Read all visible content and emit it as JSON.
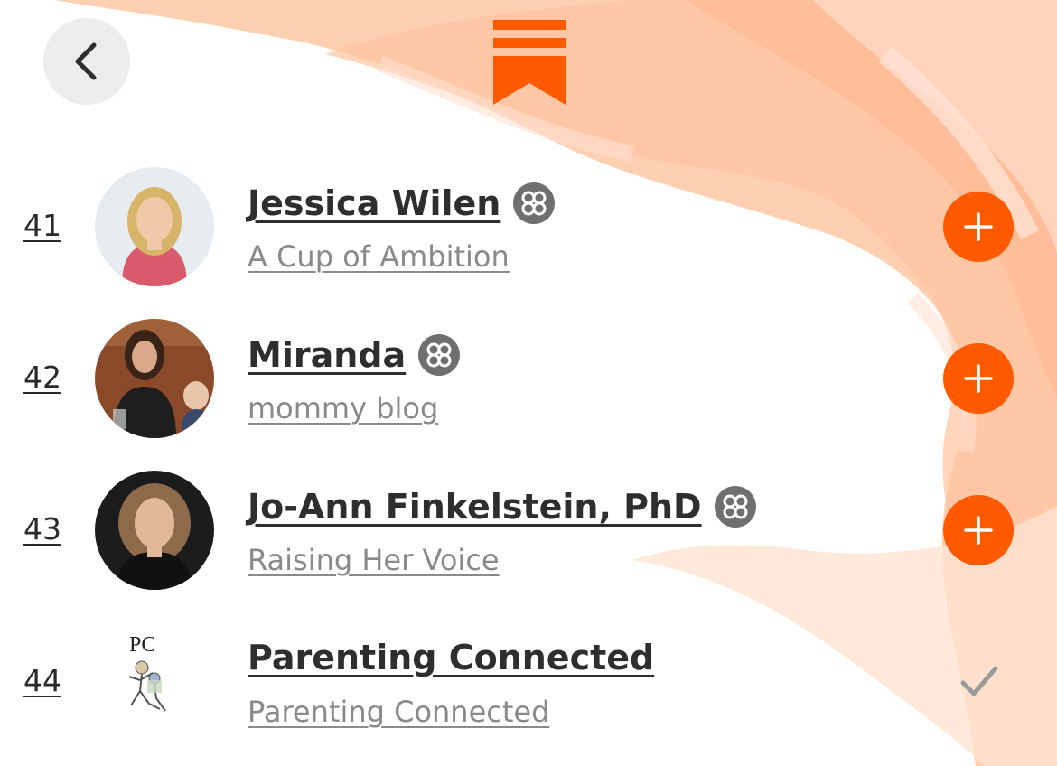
{
  "colors": {
    "accent": "#FF5A00",
    "badge": "#6F6F6F",
    "back_button_bg": "#ECECEC",
    "text_primary": "#2E2E2E",
    "text_secondary": "#8A8A8A",
    "check": "#9A9A9A"
  },
  "header": {
    "back_icon": "chevron-left-icon",
    "logo_icon": "substack-bookmark-icon"
  },
  "leaderboard": [
    {
      "rank": "41",
      "name": "Jessica Wilen",
      "publication": "A Cup of Ambition",
      "has_badge": true,
      "badge_icon": "flower-badge-icon",
      "action": "follow",
      "action_icon": "plus-icon"
    },
    {
      "rank": "42",
      "name": "Miranda",
      "publication": "mommy blog",
      "has_badge": true,
      "badge_icon": "flower-badge-icon",
      "action": "follow",
      "action_icon": "plus-icon"
    },
    {
      "rank": "43",
      "name": "Jo-Ann Finkelstein, PhD",
      "publication": "Raising Her Voice",
      "has_badge": true,
      "badge_icon": "flower-badge-icon",
      "action": "follow",
      "action_icon": "plus-icon"
    },
    {
      "rank": "44",
      "name": "Parenting Connected",
      "publication": "Parenting Connected",
      "logo_text": "PC",
      "has_badge": false,
      "action": "subscribed",
      "action_icon": "checkmark-icon"
    }
  ]
}
